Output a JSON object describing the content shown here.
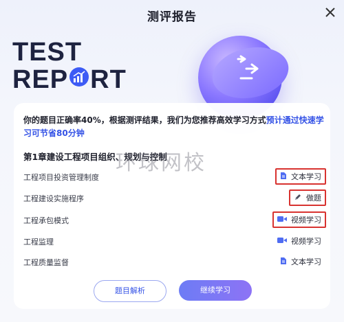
{
  "header": {
    "title": "测评报告",
    "close_icon": "close-icon"
  },
  "hero": {
    "line1": "TEST",
    "line2_a": "REP",
    "line2_b": "RT"
  },
  "summary": {
    "part1": "你的题目正确率40%，根据测评结果，我们为您推荐高效学习方式",
    "highlight": "预计通过快速学习可节省80分钟"
  },
  "chapter": {
    "title": "第1章建设工程项目组织、规划与控制"
  },
  "watermark": "环球网校",
  "items": [
    {
      "label": "工程项目投资管理制度",
      "action": "文本学习",
      "icon": "document-icon",
      "highlighted": true
    },
    {
      "label": "工程建设实施程序",
      "action": "做题",
      "icon": "pencil-icon",
      "highlighted": true
    },
    {
      "label": "工程承包模式",
      "action": "视频学习",
      "icon": "video-icon",
      "highlighted": true
    },
    {
      "label": "工程监理",
      "action": "视频学习",
      "icon": "video-icon",
      "highlighted": false
    },
    {
      "label": "工程质量监督",
      "action": "文本学习",
      "icon": "document-icon",
      "highlighted": false
    }
  ],
  "buttons": {
    "analysis": "题目解析",
    "continue": "继续学习"
  },
  "colors": {
    "accent": "#3452e6",
    "button_gradient_start": "#6d7cf5",
    "button_gradient_end": "#8d73f5",
    "highlight_box": "#d8322f"
  }
}
